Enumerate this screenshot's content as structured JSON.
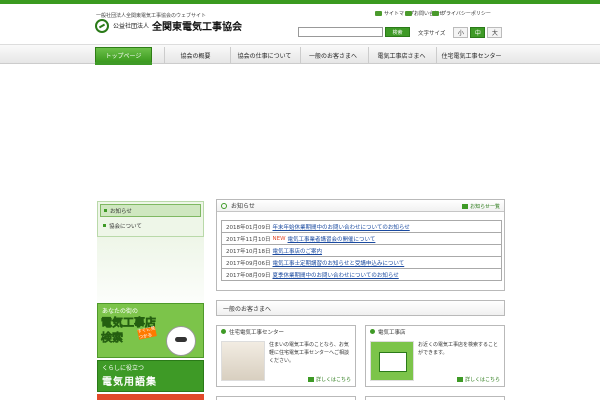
{
  "header": {
    "tagline": "一般社団法人全関東電気工事協会のウェブサイト",
    "org_small": "公益社団法人",
    "org_name": "全関東電気工事協会",
    "util_links": [
      "サイトマップ",
      "お問い合わせ",
      "プライバシーポリシー"
    ],
    "search_placeholder": "",
    "search_button": "検索",
    "font_size_label": "文字サイズ",
    "font_sizes": [
      "小",
      "中",
      "大"
    ]
  },
  "nav": {
    "items": [
      "トップページ",
      "協会の概要",
      "協会の仕事について",
      "一般のお客さまへ",
      "電気工事店さまへ",
      "住宅電気工事センター"
    ],
    "active_index": 0
  },
  "sidebar": {
    "items": [
      "お知らせ",
      "協会について"
    ]
  },
  "banners": {
    "b1_line1": "あなたの街の",
    "b1_line2": "電気工事店",
    "b1_line3": "検索",
    "b1_sticker": "すぐに見つかる",
    "b2_line1": "くらしに役立つ",
    "b2_line2": "電気用語集"
  },
  "news": {
    "title": "お知らせ",
    "more": "お知らせ一覧",
    "items": [
      {
        "date": "2018年01月09日",
        "badge": "",
        "text": "年末年始休業期間中のお問い合わせについてのお知らせ"
      },
      {
        "date": "2017年11月10日",
        "badge": "NEW",
        "text": "電気工事業者講習会の開催について"
      },
      {
        "date": "2017年10月18日",
        "badge": "",
        "text": "電気工事店のご案内"
      },
      {
        "date": "2017年09月06日",
        "badge": "",
        "text": "電気工事士定期講習のお知らせと受講申込みについて"
      },
      {
        "date": "2017年08月09日",
        "badge": "",
        "text": "夏季休業期間中のお問い合わせについてのお知らせ"
      }
    ]
  },
  "guide": {
    "title": "一般のお客さまへ",
    "cards": [
      {
        "title": "住宅電気工事センター",
        "text": "住まいの電気工事のことなら、お気軽に住宅電気工事センターへご相談ください。",
        "more": "詳しくはこちら"
      },
      {
        "title": "電気工事店",
        "text": "お近くの電気工事店を検索することができます。",
        "more": "詳しくはこちら"
      }
    ]
  }
}
